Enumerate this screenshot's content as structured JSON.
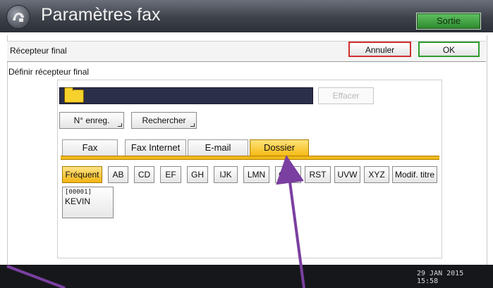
{
  "app": {
    "title": "Paramètres fax",
    "exit_label": "Sortie"
  },
  "header": {
    "title": "Récepteur final",
    "cancel_label": "Annuler",
    "ok_label": "OK"
  },
  "section": {
    "title": "Définir récepteur final"
  },
  "destination": {
    "clear_label": "Effacer"
  },
  "actions": {
    "regno_label": "N° enreg.",
    "search_label": "Rechercher"
  },
  "tabs": [
    {
      "label": "Fax"
    },
    {
      "label": "Fax Internet"
    },
    {
      "label": "E-mail"
    },
    {
      "label": "Dossier",
      "active": true
    }
  ],
  "letters": [
    "Fréquent",
    "AB",
    "CD",
    "EF",
    "GH",
    "IJK",
    "LMN",
    "OPQ",
    "RST",
    "UVW",
    "XYZ",
    "Modif. titre"
  ],
  "entries": [
    {
      "number": "[00001]",
      "name": "KEVIN"
    }
  ],
  "status": {
    "date": "29 JAN  2015",
    "time": "15:58"
  },
  "colors": {
    "accent": "#f5b912",
    "title_bar": "#3d414a",
    "ok": "#2e9b2e",
    "cancel": "#d03030",
    "annotation": "#7a3fa0"
  }
}
